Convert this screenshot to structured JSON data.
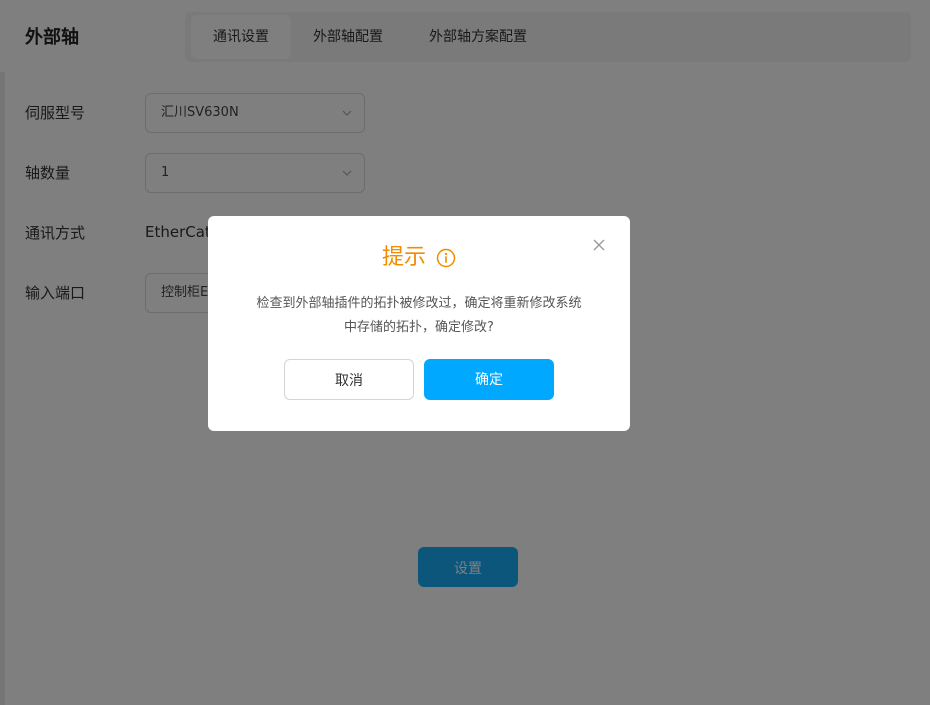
{
  "header": {
    "title": "外部轴",
    "tabs": [
      {
        "label": "通讯设置",
        "active": true
      },
      {
        "label": "外部轴配置",
        "active": false
      },
      {
        "label": "外部轴方案配置",
        "active": false
      }
    ]
  },
  "form": {
    "servo_model": {
      "label": "伺服型号",
      "value": "汇川SV630N"
    },
    "axis_count": {
      "label": "轴数量",
      "value": "1"
    },
    "comm_mode": {
      "label": "通讯方式",
      "value": "EtherCat"
    },
    "input_port": {
      "label": "输入端口",
      "value": "控制柜E"
    }
  },
  "setup_button": "设置",
  "dialog": {
    "title": "提示",
    "message_line1": "检查到外部轴插件的拓扑被修改过，确定将重新修改系统",
    "message_line2": "中存储的拓扑，确定修改?",
    "cancel_label": "取消",
    "confirm_label": "确定"
  },
  "colors": {
    "accent": "#00a8ff",
    "title_orange": "#f08c00",
    "overlay": "rgba(0,0,0,0.5)"
  },
  "icons": {
    "dialog_title_icon": "info-circle-icon",
    "dialog_close": "close-icon",
    "select_arrow": "chevron-down-icon"
  }
}
